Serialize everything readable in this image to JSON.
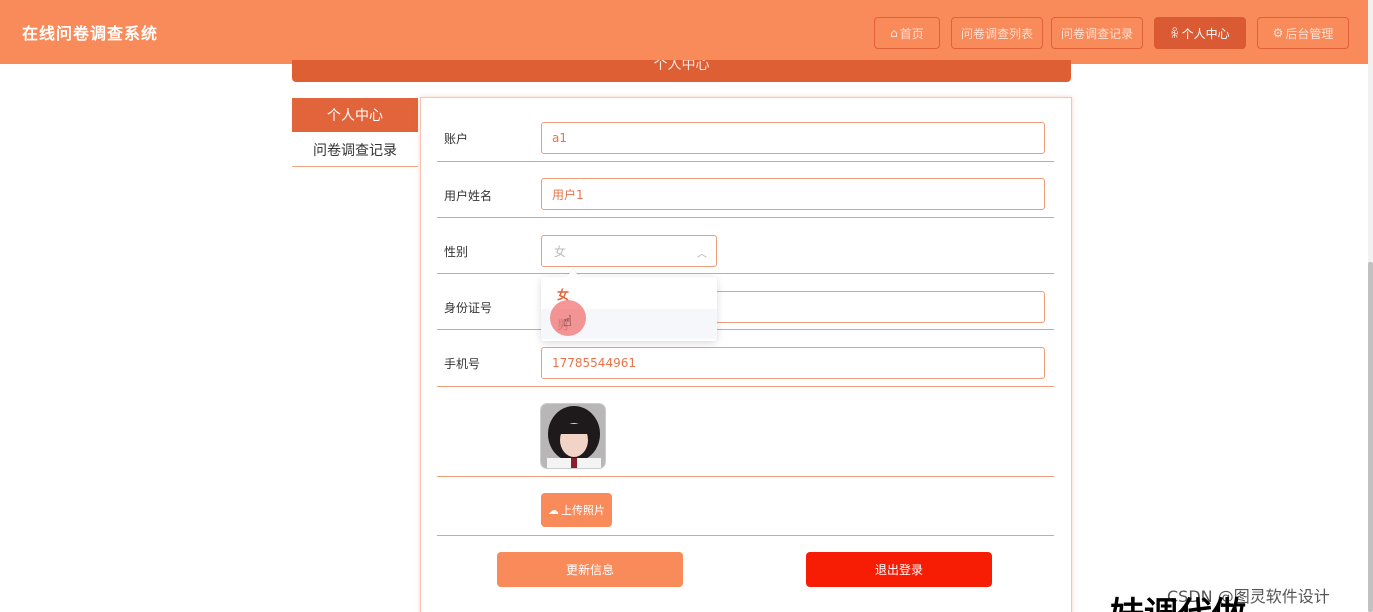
{
  "app": {
    "title": "在线问卷调查系统"
  },
  "nav": {
    "items": [
      {
        "label": "首页"
      },
      {
        "label": "问卷调查列表"
      },
      {
        "label": "问卷调查记录"
      },
      {
        "label": "个人中心"
      },
      {
        "label": "后台管理"
      }
    ]
  },
  "page": {
    "title": "个人中心"
  },
  "sidebar": {
    "items": [
      {
        "label": "个人中心"
      },
      {
        "label": "问卷调查记录"
      }
    ]
  },
  "form": {
    "account": {
      "label": "账户",
      "value": "a1"
    },
    "name": {
      "label": "用户姓名",
      "value": "用户1"
    },
    "gender": {
      "label": "性别",
      "selected": "女",
      "options": [
        "女",
        "男"
      ]
    },
    "idcard": {
      "label": "身份证号",
      "value": ""
    },
    "phone": {
      "label": "手机号",
      "value": "17785544961"
    },
    "upload_label": "上传照片",
    "update_label": "更新信息",
    "logout_label": "退出登录"
  },
  "colors": {
    "accent": "#f98a5a",
    "accent_dark": "#e2643a",
    "danger": "#f71d05"
  },
  "watermark": "CSDN @图灵软件设计",
  "overlay": "妹调代做"
}
